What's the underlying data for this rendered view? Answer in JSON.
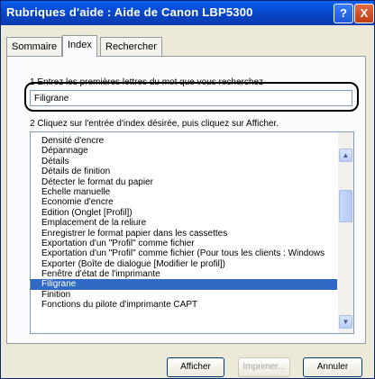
{
  "window": {
    "title": "Rubriques d'aide : Aide de Canon LBP5300",
    "help_glyph": "?",
    "close_glyph": "X"
  },
  "tabs": [
    {
      "label": "Sommaire",
      "active": false
    },
    {
      "label": "Index",
      "active": true
    },
    {
      "label": "Rechercher",
      "active": false
    }
  ],
  "step1_label": "1  Entrez les premières lettres du mot que vous recherchez",
  "search_value": "Filigrane",
  "step2_label": "2  Cliquez sur l'entrée d'index désirée, puis cliquez sur Afficher.",
  "index_items": [
    {
      "label": "Densité d'encre",
      "selected": false
    },
    {
      "label": "Dépannage",
      "selected": false
    },
    {
      "label": "Détails",
      "selected": false
    },
    {
      "label": "Détails de finition",
      "selected": false
    },
    {
      "label": "Détecter le format du papier",
      "selected": false
    },
    {
      "label": "Echelle manuelle",
      "selected": false
    },
    {
      "label": "Economie d'encre",
      "selected": false
    },
    {
      "label": "Édition (Onglet [Profil])",
      "selected": false
    },
    {
      "label": "Emplacement de la reliure",
      "selected": false
    },
    {
      "label": "Enregistrer le format papier dans les cassettes",
      "selected": false
    },
    {
      "label": "Exportation d'un \"Profil\" comme fichier",
      "selected": false
    },
    {
      "label": "Exportation d'un \"Profil\" comme fichier (Pour tous les clients : Windows",
      "selected": false
    },
    {
      "label": "Exporter (Boîte de dialogue [Modifier le profil])",
      "selected": false
    },
    {
      "label": "Fenêtre d'état de l'imprimante",
      "selected": false
    },
    {
      "label": "Filigrane",
      "selected": true
    },
    {
      "label": "Finition",
      "selected": false
    },
    {
      "label": "Fonctions du pilote d'imprimante CAPT",
      "selected": false
    }
  ],
  "buttons": {
    "display": "Afficher",
    "print": "Imprimer...",
    "cancel": "Annuler"
  },
  "colors": {
    "title_bar": "#0a5ef0",
    "selection": "#316ac5",
    "highlight_outline": "#000000"
  }
}
